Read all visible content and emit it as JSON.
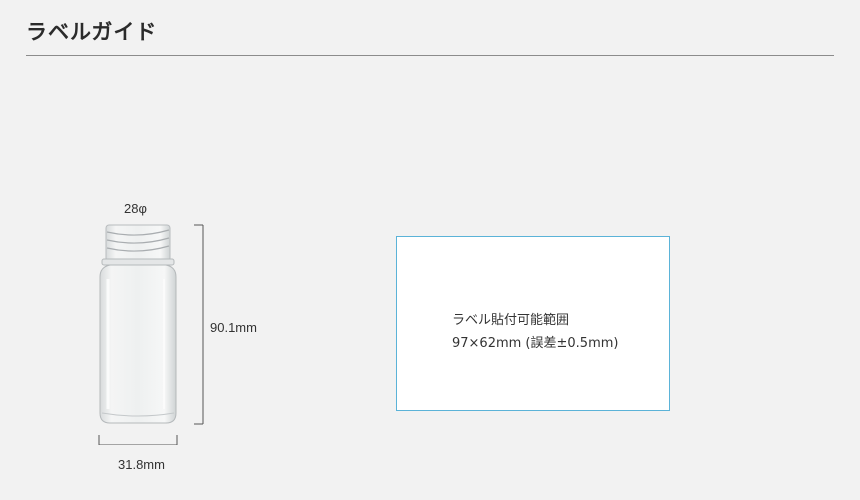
{
  "header": {
    "title": "ラベルガイド"
  },
  "bottle": {
    "neck_label": "28φ",
    "height_label": "90.1mm",
    "width_label": "31.8mm"
  },
  "label_area": {
    "title": "ラベル貼付可能範囲",
    "size": "97×62mm (誤差±0.5mm)",
    "border_color": "#5bb3d8"
  },
  "colors": {
    "background": "#f2f2f2",
    "rule": "#8c8c8c",
    "dimension_lines": "#555555"
  }
}
